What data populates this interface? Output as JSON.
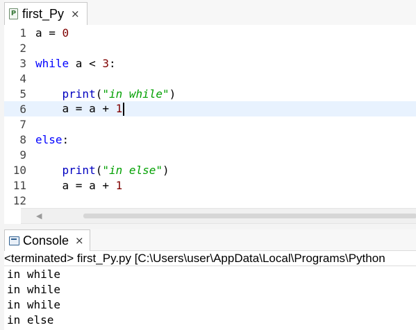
{
  "editor": {
    "tab": {
      "label": "first_Py",
      "icon": "python-file-icon",
      "close": "×"
    },
    "current_line": 6,
    "lines": [
      {
        "n": "1",
        "tokens": [
          {
            "t": "a = ",
            "c": "default"
          },
          {
            "t": "0",
            "c": "number"
          }
        ]
      },
      {
        "n": "2",
        "tokens": []
      },
      {
        "n": "3",
        "tokens": [
          {
            "t": "while",
            "c": "keyword"
          },
          {
            "t": " a < ",
            "c": "default"
          },
          {
            "t": "3",
            "c": "number"
          },
          {
            "t": ":",
            "c": "default"
          }
        ]
      },
      {
        "n": "4",
        "tokens": []
      },
      {
        "n": "5",
        "tokens": [
          {
            "t": "    ",
            "c": "default"
          },
          {
            "t": "print",
            "c": "func"
          },
          {
            "t": "(",
            "c": "default"
          },
          {
            "t": "\"in while\"",
            "c": "string"
          },
          {
            "t": ")",
            "c": "default"
          }
        ]
      },
      {
        "n": "6",
        "tokens": [
          {
            "t": "    a = a + ",
            "c": "default"
          },
          {
            "t": "1",
            "c": "number"
          }
        ]
      },
      {
        "n": "7",
        "tokens": []
      },
      {
        "n": "8",
        "tokens": [
          {
            "t": "else",
            "c": "keyword"
          },
          {
            "t": ":",
            "c": "default"
          }
        ]
      },
      {
        "n": "9",
        "tokens": []
      },
      {
        "n": "10",
        "tokens": [
          {
            "t": "    ",
            "c": "default"
          },
          {
            "t": "print",
            "c": "func"
          },
          {
            "t": "(",
            "c": "default"
          },
          {
            "t": "\"in else\"",
            "c": "string"
          },
          {
            "t": ")",
            "c": "default"
          }
        ]
      },
      {
        "n": "11",
        "tokens": [
          {
            "t": "    a = a + ",
            "c": "default"
          },
          {
            "t": "1",
            "c": "number"
          }
        ]
      },
      {
        "n": "12",
        "tokens": []
      }
    ],
    "colors": {
      "keyword": "#0000ff",
      "number": "#7f0000",
      "func": "#0000c0",
      "string": "#00a000",
      "current_line_bg": "#e8f2fe"
    }
  },
  "console": {
    "tab": {
      "label": "Console",
      "icon": "console-icon",
      "close": "×"
    },
    "header": "<terminated> first_Py.py [C:\\Users\\user\\AppData\\Local\\Programs\\Python",
    "output": [
      "in while",
      "in while",
      "in while",
      "in else"
    ]
  }
}
